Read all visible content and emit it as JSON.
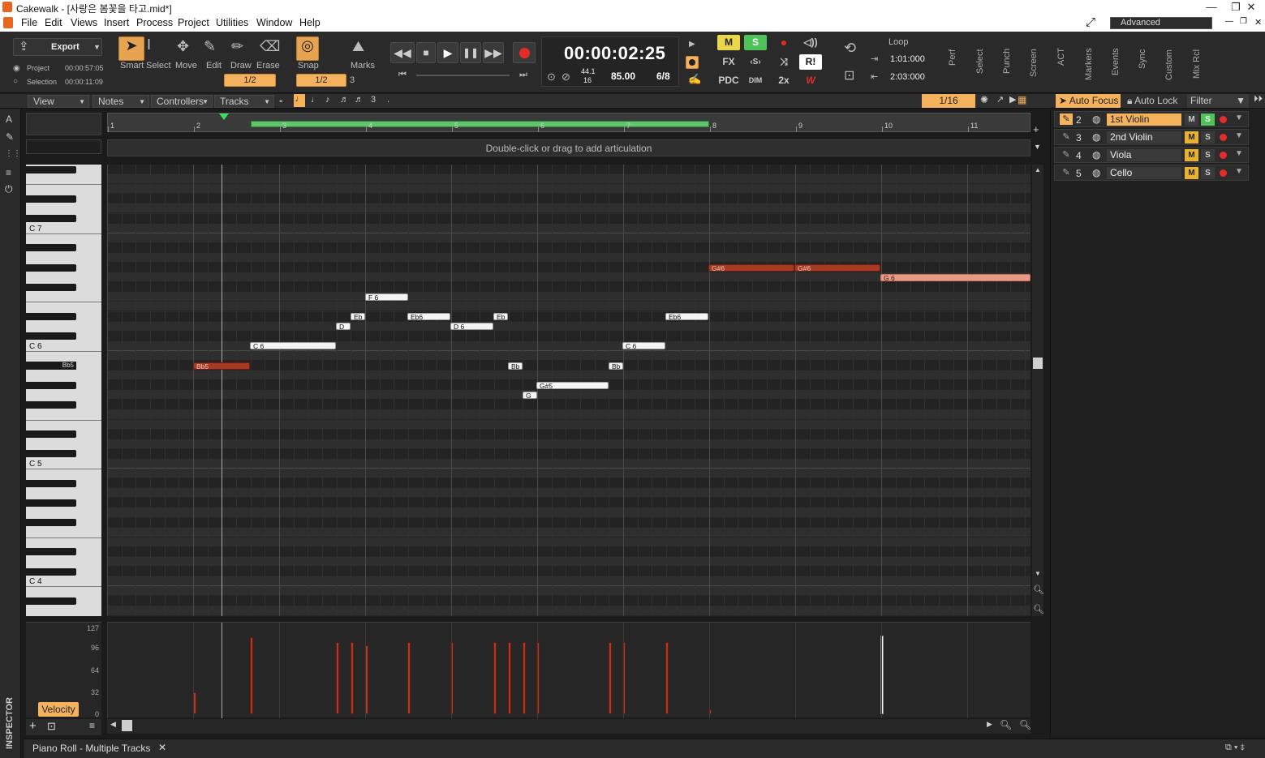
{
  "window": {
    "title": "Cakewalk - [사랑은 봄꽃을 타고.mid*]",
    "min": "—",
    "restore": "❐",
    "close": "✕"
  },
  "menu": [
    "File",
    "Edit",
    "Views",
    "Insert",
    "Process",
    "Project",
    "Utilities",
    "Window",
    "Help"
  ],
  "workspace": "Advanced",
  "toolbar": {
    "export_label": "Export",
    "project_label": "Project",
    "project_time": "00:00:57:05",
    "selection_label": "Selection",
    "selection_time": "00:00:11:09",
    "tools": [
      "Smart",
      "Select",
      "Move",
      "Edit",
      "Draw",
      "Erase"
    ],
    "tool_value": "1/2",
    "snap_label": "Snap",
    "snap_value": "1/2",
    "snap_extra": "3",
    "marks_label": "Marks",
    "time": "00:00:02:25",
    "sample_rate": "44.1",
    "bit_depth": "16",
    "tempo": "85.00",
    "meter": "6/8",
    "mix": {
      "m": "M",
      "s": "S",
      "fx": "FX",
      "pdc": "PDC",
      "dim": "DIM",
      "two_x": "2x",
      "r": "R!",
      "w": "W"
    },
    "loop_label": "Loop",
    "loop_start": "1:01:000",
    "loop_end": "2:03:000",
    "modules": [
      "Perf",
      "Select",
      "Punch",
      "Screen",
      "ACT",
      "Markers",
      "Events",
      "Sync",
      "Custom",
      "Mix Rcl"
    ]
  },
  "pianoroll": {
    "menus": [
      "View",
      "Notes",
      "Controllers",
      "Tracks"
    ],
    "snap": "1/16",
    "articulation_hint": "Double-click or drag to add articulation",
    "ruler": [
      "1",
      "2",
      "3",
      "4",
      "5",
      "6",
      "7",
      "8",
      "9",
      "10",
      "11"
    ],
    "key_labels": [
      "C 7",
      "C 6",
      "C 5",
      "C 4"
    ],
    "highlighted_key": "Bb5",
    "notes": [
      {
        "label": "Bb5",
        "style": "red"
      },
      {
        "label": "C 6",
        "style": "white"
      },
      {
        "label": "D",
        "style": "white"
      },
      {
        "label": "Eb",
        "style": "white"
      },
      {
        "label": "F 6",
        "style": "white"
      },
      {
        "label": "Eb6",
        "style": "white"
      },
      {
        "label": "D 6",
        "style": "white"
      },
      {
        "label": "Eb",
        "style": "white"
      },
      {
        "label": "Bb",
        "style": "white"
      },
      {
        "label": "G",
        "style": "white"
      },
      {
        "label": "G#5",
        "style": "white"
      },
      {
        "label": "Bb",
        "style": "white"
      },
      {
        "label": "C 6",
        "style": "white"
      },
      {
        "label": "Eb6",
        "style": "white"
      },
      {
        "label": "G#6",
        "style": "red"
      },
      {
        "label": "G#6",
        "style": "red"
      },
      {
        "label": "G 6",
        "style": "light"
      }
    ],
    "velocity": {
      "label": "Velocity",
      "axis": [
        "127",
        "96",
        "64",
        "32",
        "0"
      ]
    },
    "auto_focus": "Auto Focus",
    "auto_lock": "Auto Lock",
    "filter": "Filter",
    "tracks": [
      {
        "num": "2",
        "name": "1st Violin",
        "m": "M",
        "s": "S",
        "active": true
      },
      {
        "num": "3",
        "name": "2nd Violin",
        "m": "M",
        "s": "S",
        "active": false
      },
      {
        "num": "4",
        "name": "Viola",
        "m": "M",
        "s": "S",
        "active": false
      },
      {
        "num": "5",
        "name": "Cello",
        "m": "M",
        "s": "S",
        "active": false
      }
    ],
    "tab": "Piano Roll - Multiple Tracks"
  },
  "inspector_label": "INSPECTOR"
}
